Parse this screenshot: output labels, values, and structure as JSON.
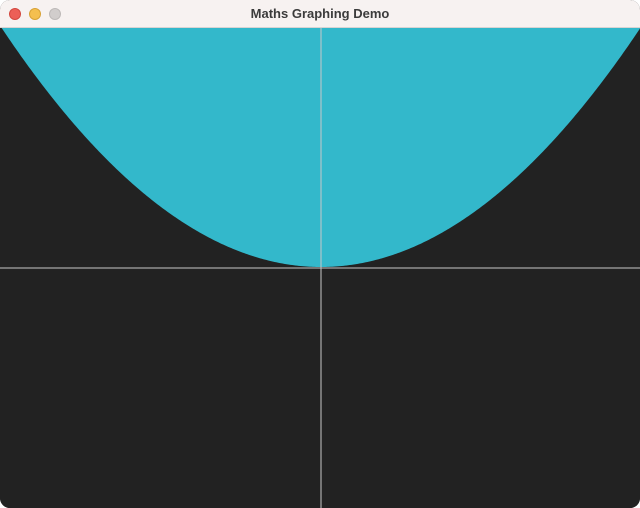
{
  "window": {
    "title": "Maths Graphing Demo"
  },
  "plot": {
    "function": "y = x^2",
    "fill": "above-curve",
    "fill_color": "#33b8cb",
    "background_color": "#222222",
    "axis_color": "#c8c8c8",
    "x_range": [
      -1,
      1
    ],
    "y_range": [
      -1,
      1
    ]
  }
}
